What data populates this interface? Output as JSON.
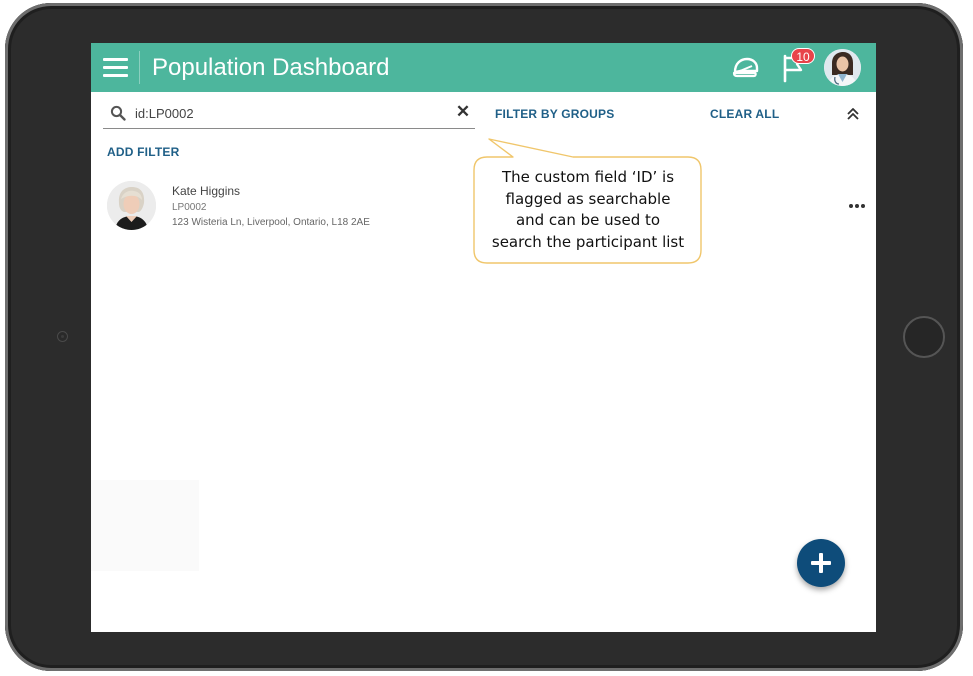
{
  "app": {
    "title": "Population Dashboard"
  },
  "header": {
    "notification_count": "10"
  },
  "search": {
    "value": "id:LP0002",
    "clear_symbol": "✕"
  },
  "filters": {
    "filter_by_groups": "FILTER BY GROUPS",
    "clear_all": "CLEAR ALL",
    "add_filter": "ADD FILTER"
  },
  "participants": [
    {
      "name": "Kate Higgins",
      "id": "LP0002",
      "address": "123 Wisteria Ln, Liverpool, Ontario, L18 2AE"
    }
  ],
  "callout": {
    "lines": [
      "The custom field ‘ID’ is",
      "flagged as searchable",
      "and can be used to",
      "search the participant list"
    ]
  },
  "colors": {
    "appbar": "#4db69d",
    "link": "#1f5f87",
    "fab": "#0e4c7a",
    "badge": "#e8434a",
    "callout_border": "#f0c66b"
  },
  "icons": {
    "menu": "menu-icon",
    "helmet": "helmet-icon",
    "flag": "flag-icon",
    "search": "search-icon",
    "clear": "close-icon",
    "collapse": "chevron-double-up-icon",
    "more": "more-horizontal-icon",
    "add": "plus-icon"
  }
}
